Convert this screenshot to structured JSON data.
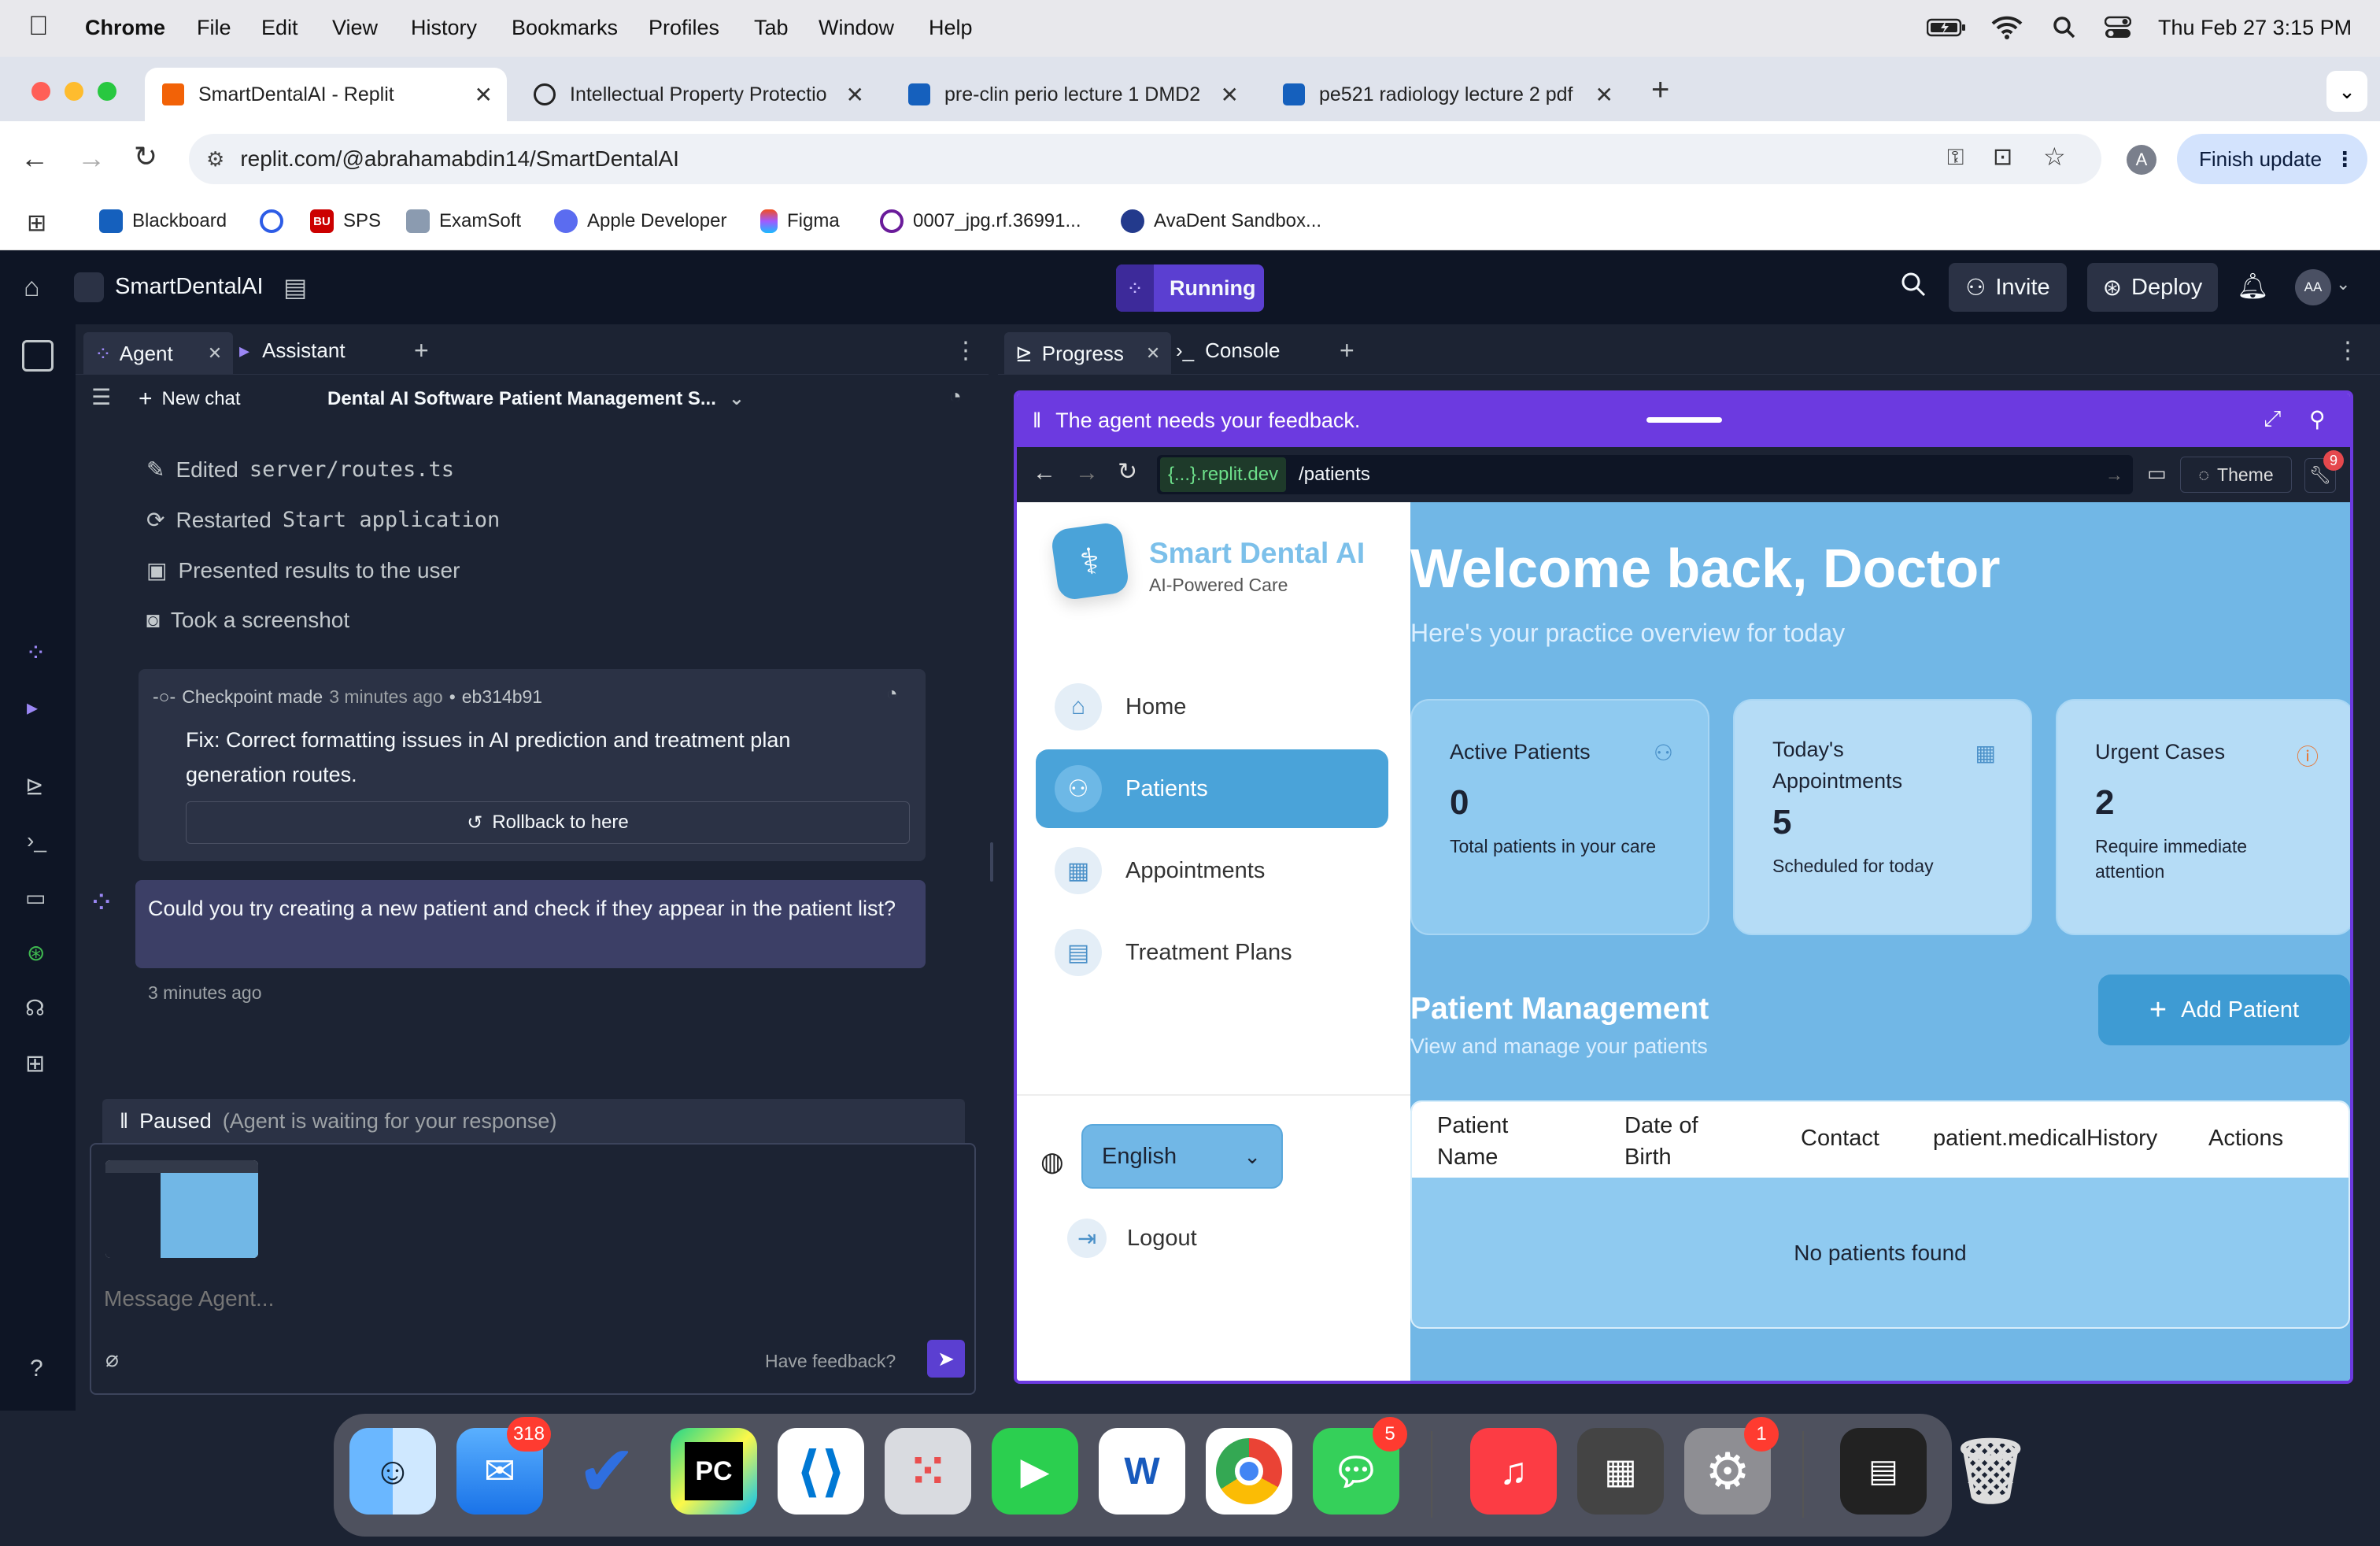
{
  "menubar": {
    "app": "Chrome",
    "items": [
      "File",
      "Edit",
      "View",
      "History",
      "Bookmarks",
      "Profiles",
      "Tab",
      "Window",
      "Help"
    ],
    "datetime": "Thu Feb 27  3:15 PM"
  },
  "browser": {
    "tabs": [
      {
        "title": "SmartDentalAI - Replit",
        "active": true
      },
      {
        "title": "Intellectual Property Protectio"
      },
      {
        "title": "pre-clin perio lecture 1 DMD2"
      },
      {
        "title": "pe521 radiology lecture 2 pdf"
      }
    ],
    "url": "replit.com/@abrahamabdin14/SmartDentalAI",
    "finish_update": "Finish update",
    "profile_initial": "A",
    "bookmarks": [
      "Blackboard",
      "",
      "SPS",
      "ExamSoft",
      "Apple Developer",
      "Figma",
      "0007_jpg.rf.36991...",
      "AvaDent Sandbox..."
    ],
    "bookmark_prefixes": {
      "sps": "BU"
    }
  },
  "replit": {
    "project_name": "SmartDentalAI",
    "run_status": "Running",
    "invite": "Invite",
    "deploy": "Deploy",
    "avatar": "AA",
    "left_tabs": [
      "Agent",
      "Assistant"
    ],
    "new_chat": "New chat",
    "chat_title": "Dental AI Software Patient Management S...",
    "activity": [
      {
        "verb": "Edited",
        "code": "server/routes.ts",
        "icon": "edit-icon"
      },
      {
        "verb": "Restarted",
        "code": "Start application",
        "icon": "restart-icon"
      },
      {
        "verb": "Presented results to the user",
        "code": "",
        "icon": "present-icon"
      },
      {
        "verb": "Took a screenshot",
        "code": "",
        "icon": "camera-icon"
      }
    ],
    "checkpoint": {
      "label": "Checkpoint made",
      "time": "3 minutes ago",
      "hash": "eb314b91",
      "message": "Fix: Correct formatting issues in AI prediction and treatment plan generation routes.",
      "rollback": "Rollback to here"
    },
    "user_message": {
      "text": "Could you try creating a new patient and check if they appear in the patient list?",
      "time": "3 minutes ago"
    },
    "paused": {
      "label": "Paused",
      "detail": "(Agent is waiting for your response)"
    },
    "message_placeholder": "Message Agent...",
    "have_feedback": "Have feedback?",
    "right_tabs": [
      "Progress",
      "Console"
    ],
    "feedback_banner": "The agent needs your feedback.",
    "preview_domain": "{...}.replit.dev",
    "preview_path": "/patients",
    "theme_label": "Theme",
    "devtools_badge": "9"
  },
  "app": {
    "brand": "Smart Dental AI",
    "tagline": "AI-Powered Care",
    "nav": [
      {
        "label": "Home",
        "icon": "home-icon"
      },
      {
        "label": "Patients",
        "icon": "users-icon",
        "active": true
      },
      {
        "label": "Appointments",
        "icon": "calendar-icon"
      },
      {
        "label": "Treatment Plans",
        "icon": "document-icon"
      }
    ],
    "language": "English",
    "logout": "Logout",
    "welcome": "Welcome back, Doctor",
    "welcome_sub": "Here's your practice overview for today",
    "cards": [
      {
        "title": "Active Patients",
        "value": "0",
        "sub": "Total patients in your care",
        "icon": "user-icon"
      },
      {
        "title": "Today's Appointments",
        "value": "5",
        "sub": "Scheduled for today",
        "icon": "calendar-icon"
      },
      {
        "title": "Urgent Cases",
        "value": "2",
        "sub": "Require immediate attention",
        "icon": "alert-icon"
      }
    ],
    "pm_title": "Patient Management",
    "pm_sub": "View and manage your patients",
    "add_patient": "Add Patient",
    "table_headers": [
      "Patient Name",
      "Date of Birth",
      "Contact",
      "patient.medicalHistory",
      "Actions"
    ],
    "empty": "No patients found"
  },
  "dock": {
    "badges": {
      "mail": "318",
      "messages": "5",
      "settings": "1"
    },
    "labels": {
      "pycharm": "PC",
      "word": "W"
    }
  },
  "colors": {
    "accent": "#6c3ae0",
    "app_main": "#71b7e6",
    "active_nav": "#4aa3d9"
  }
}
